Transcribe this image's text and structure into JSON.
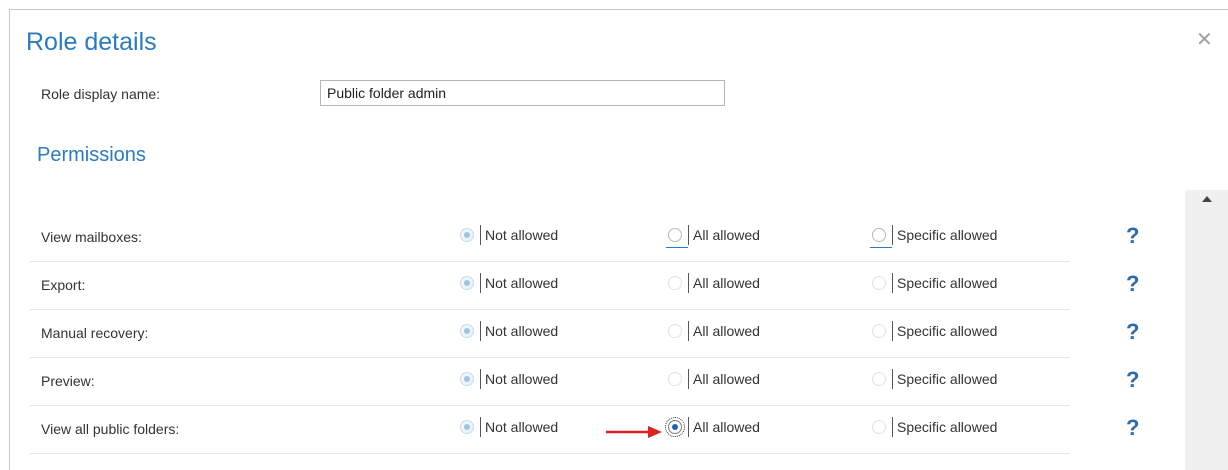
{
  "dialog": {
    "title": "Role details",
    "close_icon": "close-icon"
  },
  "role_name": {
    "label": "Role display name:",
    "value": "Public folder admin"
  },
  "permissions": {
    "title": "Permissions",
    "options": [
      "Not allowed",
      "All allowed",
      "Specific allowed"
    ],
    "help_label": "?",
    "rows": [
      {
        "label": "View mailboxes:",
        "selected": "Not allowed"
      },
      {
        "label": "Export:",
        "selected": "Not allowed"
      },
      {
        "label": "Manual recovery:",
        "selected": "Not allowed"
      },
      {
        "label": "Preview:",
        "selected": "Not allowed"
      },
      {
        "label": "View all public folders:",
        "selected": "All allowed"
      }
    ]
  },
  "colors": {
    "accent": "#2b7bc0",
    "arrow": "#e02020"
  }
}
